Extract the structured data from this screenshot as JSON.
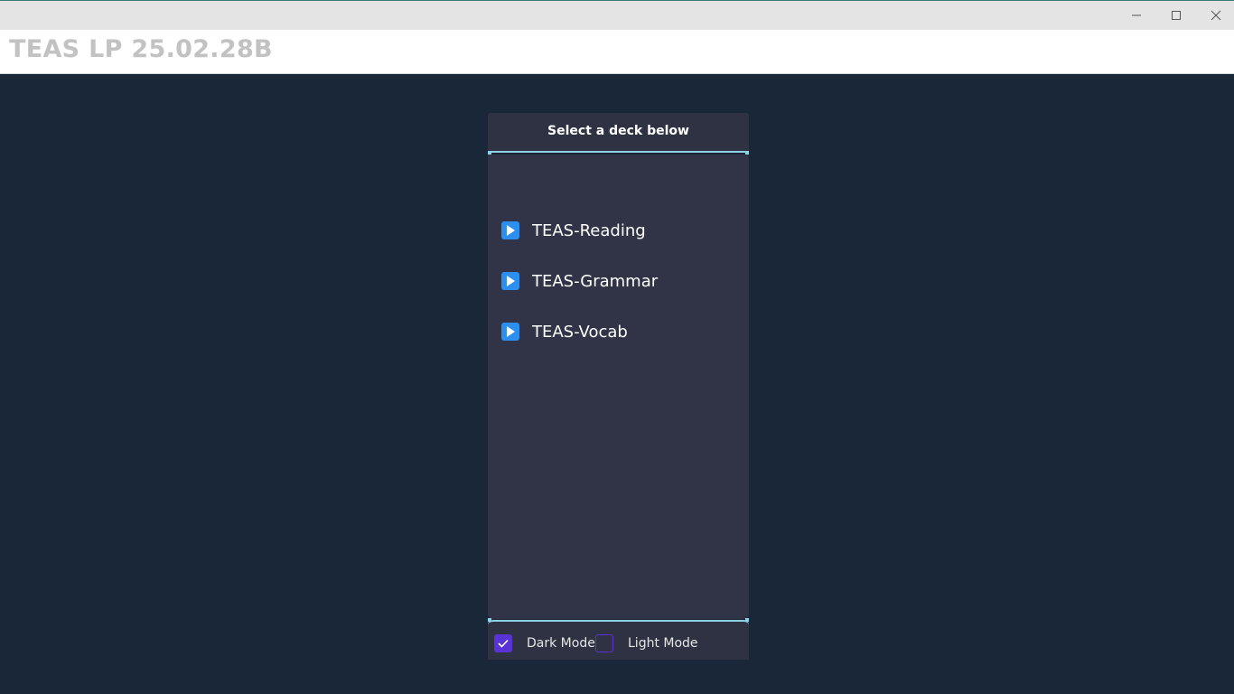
{
  "window": {
    "title": "TEAS LP 25.02.28B",
    "controls": [
      "minimize-icon",
      "maximize-icon",
      "close-icon"
    ]
  },
  "panel": {
    "title": "Select a deck below",
    "decks": [
      {
        "label": "TEAS-Reading",
        "icon": "play-icon"
      },
      {
        "label": "TEAS-Grammar",
        "icon": "play-icon"
      },
      {
        "label": "TEAS-Vocab",
        "icon": "play-icon"
      }
    ]
  },
  "theme": {
    "dark_mode": {
      "label": "Dark Mode",
      "checked": true
    },
    "light_mode": {
      "label": "Light Mode",
      "checked": false
    }
  },
  "colors": {
    "background": "#1a2738",
    "panel": "#303446",
    "accent_border": "#8ed0e6",
    "deck_icon": "#2c8ff0",
    "checkbox": "#5a33d6"
  }
}
